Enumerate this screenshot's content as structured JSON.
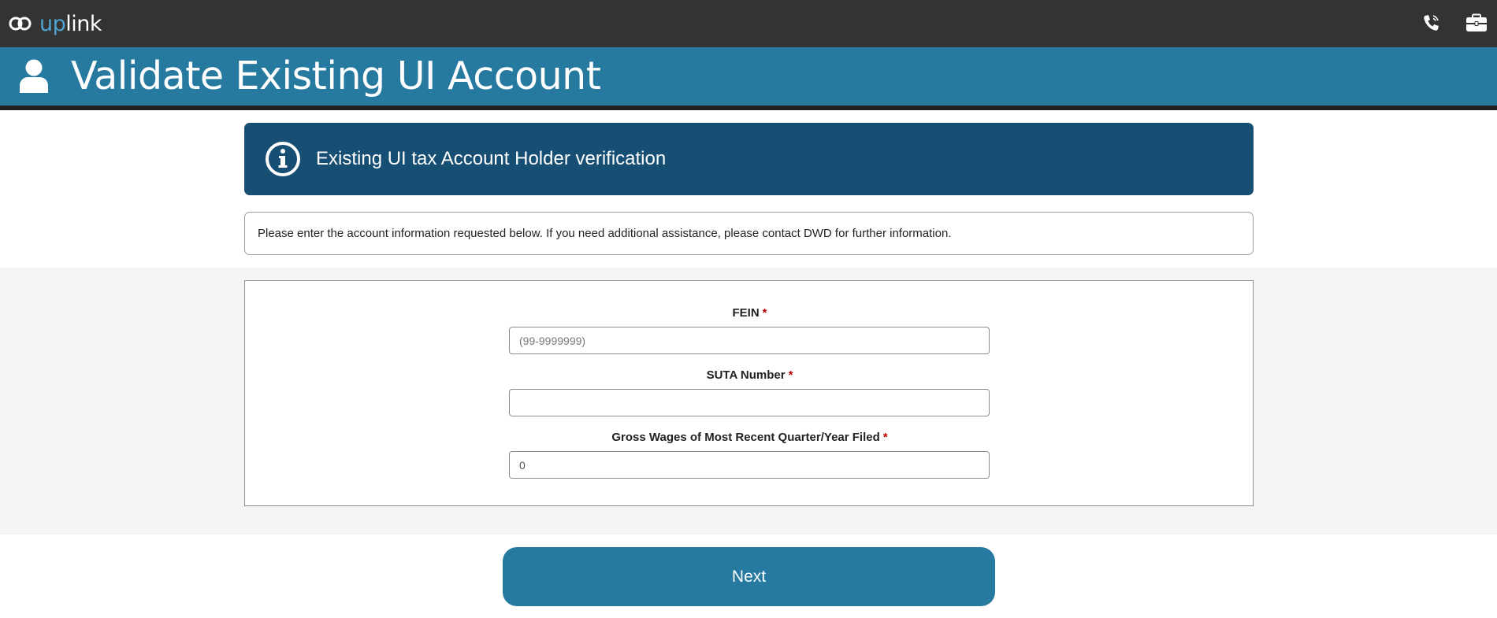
{
  "header": {
    "logo_text_up": "up",
    "logo_text_link": "link",
    "icons": [
      "phone-icon",
      "briefcase-icon"
    ]
  },
  "title_band": {
    "icon": "user-icon",
    "title": "Validate Existing UI Account"
  },
  "info_banner": {
    "icon": "info-icon",
    "title": "Existing UI tax Account Holder verification"
  },
  "notice": {
    "text": "Please enter the account information requested below. If you need additional assistance, please contact DWD for further information."
  },
  "form": {
    "fein": {
      "label": "FEIN",
      "required_mark": "*",
      "value": "",
      "placeholder": "(99-9999999)"
    },
    "suta": {
      "label": "SUTA Number",
      "required_mark": "*",
      "value": "",
      "placeholder": ""
    },
    "gross_wages": {
      "label": "Gross Wages of Most Recent Quarter/Year Filed",
      "required_mark": "*",
      "value": "0",
      "placeholder": ""
    }
  },
  "actions": {
    "next_label": "Next"
  },
  "colors": {
    "topbar": "#333333",
    "title_band": "#26799f",
    "info_banner": "#174e74",
    "required": "#c00000",
    "button": "#26799f"
  }
}
